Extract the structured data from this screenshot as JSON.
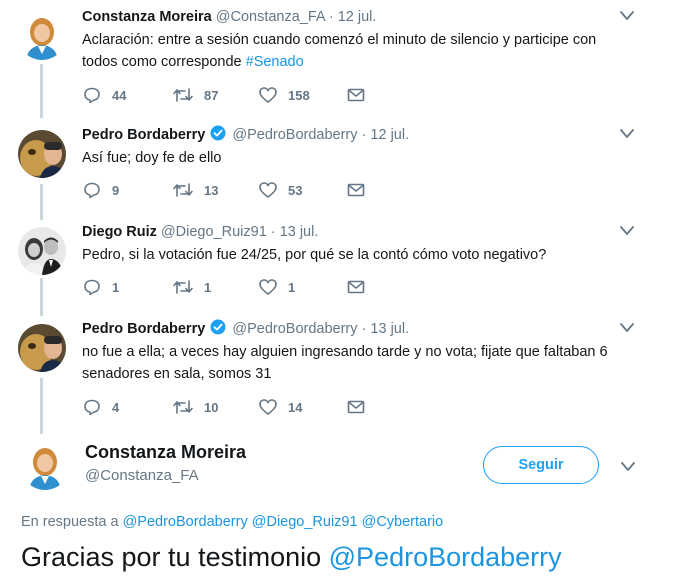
{
  "tweets": [
    {
      "name": "Constanza Moreira",
      "handle": "@Constanza_FA",
      "dot": "·",
      "time": "12 jul.",
      "text_line1": "Aclaración: entre a sesión cuando comenzó el minuto de silencio y participe con",
      "text_line2_pre": "todos como corresponde ",
      "hashtag": "#Senado",
      "replies": "44",
      "retweets": "87",
      "likes": "158"
    },
    {
      "name": "Pedro Bordaberry",
      "handle": "@PedroBordaberry",
      "dot": "·",
      "time": "12 jul.",
      "text_line1": "Así fue; doy fe de ello",
      "replies": "9",
      "retweets": "13",
      "likes": "53"
    },
    {
      "name": "Diego Ruiz",
      "handle": "@Diego_Ruiz91",
      "dot": "·",
      "time": "13 jul.",
      "text_line1": "Pedro, si la votación fue 24/25, por qué se la contó cómo voto negativo?",
      "replies": "1",
      "retweets": "1",
      "likes": "1"
    },
    {
      "name": "Pedro Bordaberry",
      "handle": "@PedroBordaberry",
      "dot": "·",
      "time": "13 jul.",
      "text_line1": "no fue a ella; a veces hay alguien ingresando tarde y no vota; fijate que faltaban 6",
      "text_line2": "senadores en sala, somos 31",
      "replies": "4",
      "retweets": "10",
      "likes": "14"
    }
  ],
  "main": {
    "name": "Constanza Moreira",
    "handle": "@Constanza_FA",
    "follow_label": "Seguir",
    "reply_prefix": "En respuesta a ",
    "reply_mention1": "@PedroBordaberry",
    "reply_mention2": "@Diego_Ruiz91",
    "reply_mention3": "@Cybertario",
    "text_pre": "Gracias por tu testimonio ",
    "text_mention": "@PedroBordaberry"
  },
  "colors": {
    "accent": "#1da1f2",
    "link": "#1b95e0",
    "muted": "#657786",
    "thread_line": "#ccd6dd"
  },
  "icons": [
    "reply-icon",
    "retweet-icon",
    "like-icon",
    "message-icon",
    "chevron-down-icon",
    "verified-icon"
  ]
}
